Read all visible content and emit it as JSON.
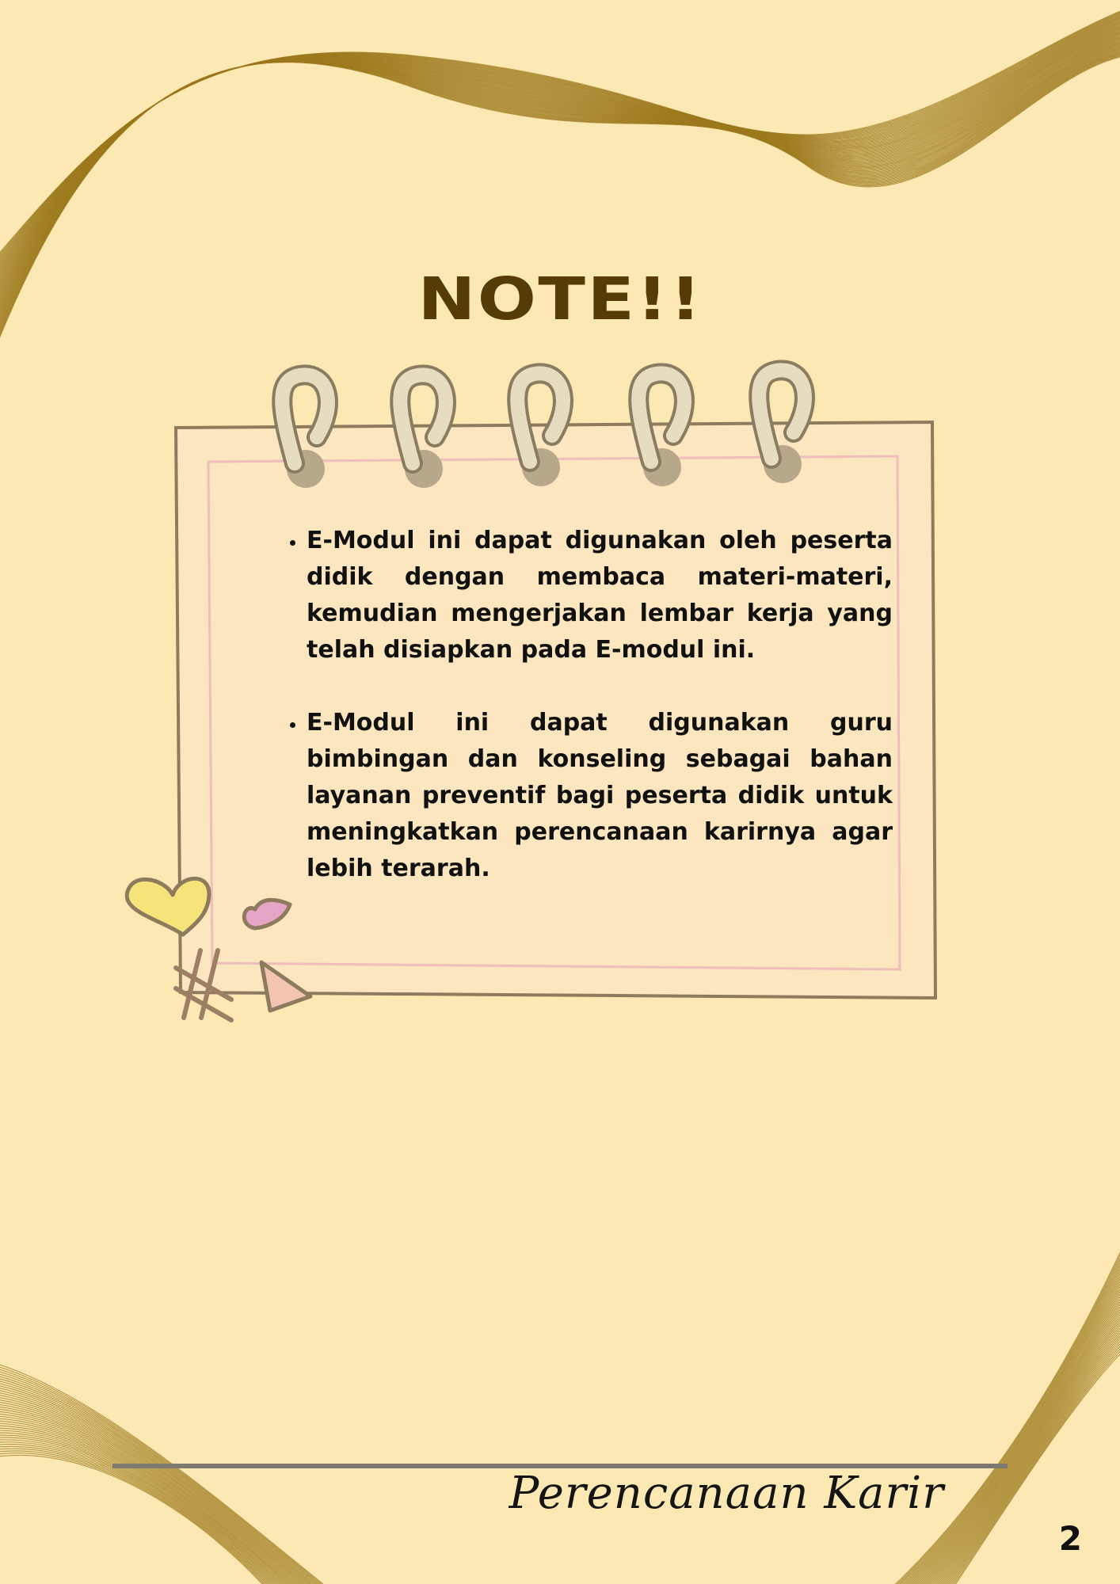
{
  "page": {
    "title": "NOTE!!",
    "notes": [
      "E-Modul ini dapat digunakan oleh peserta didik dengan membaca materi-materi, kemudian mengerjakan lembar kerja yang telah disiapkan pada E-modul ini.",
      "E-Modul ini dapat digunakan guru bimbingan dan konseling sebagai bahan layanan preventif bagi peserta didik untuk meningkatkan perencanaan karirnya agar lebih terarah."
    ],
    "footer_title": "Perencanaan Karir",
    "page_number": "2"
  },
  "colors": {
    "background": "#fce8b2",
    "title": "#553c06",
    "wave": "#9c7a1e",
    "paper": "#fbe6bf",
    "paper_border": "#8d7b5e",
    "inner_border": "#efbdbb",
    "rule": "#7f7a70"
  },
  "icons": [
    "spiral-ring-icon",
    "yellow-heart-icon",
    "pink-heart-icon",
    "hash-doodle-icon",
    "triangle-doodle-icon"
  ]
}
